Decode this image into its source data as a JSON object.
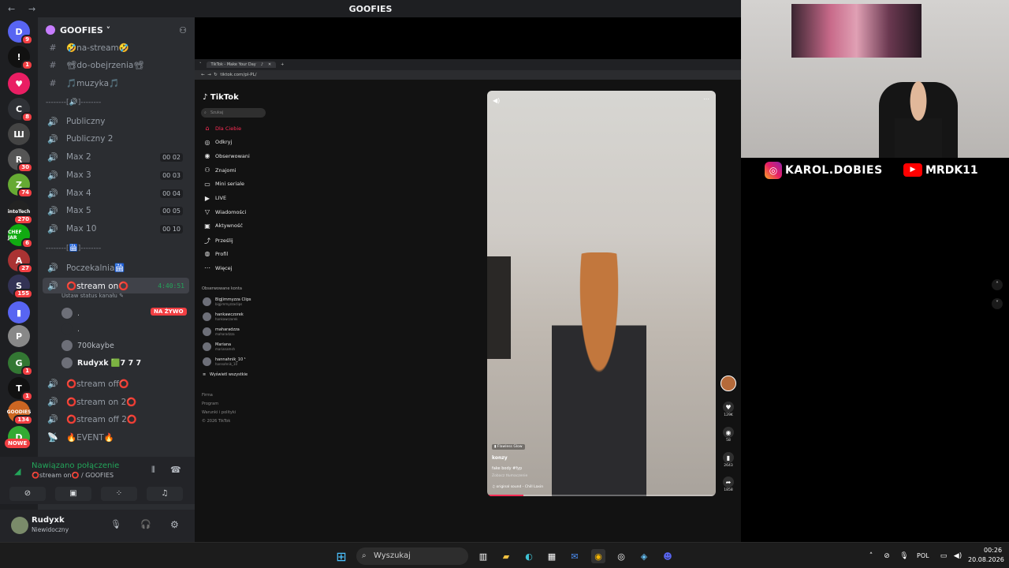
{
  "topbar": {
    "back": "←",
    "forward": "→",
    "title": "GOOFIES"
  },
  "rail": {
    "servers": [
      {
        "label": "D",
        "badge": "9",
        "color": "#5865f2"
      },
      {
        "label": "!",
        "badge": "1",
        "color": "#111"
      },
      {
        "label": "♥",
        "badge": "",
        "color": "#e91e63"
      },
      {
        "label": "C",
        "badge": "8",
        "color": "#2f3136"
      },
      {
        "label": "Ш",
        "badge": "",
        "color": "#444"
      },
      {
        "label": "R",
        "badge": "30",
        "color": "#555"
      },
      {
        "label": "Z",
        "badge": "74",
        "color": "#6a3"
      },
      {
        "label": "intoTech",
        "badge": "270",
        "color": "#222"
      },
      {
        "label": "CHEF JAR",
        "badge": "6",
        "color": "#1a1"
      },
      {
        "label": "A",
        "badge": "27",
        "color": "#a33"
      },
      {
        "label": "S",
        "badge": "155",
        "color": "#335"
      },
      {
        "label": "▮",
        "badge": "",
        "color": "#5865f2"
      },
      {
        "label": "P",
        "badge": "",
        "color": "#888"
      },
      {
        "label": "G",
        "badge": "1",
        "color": "#373"
      },
      {
        "label": "T",
        "badge": "1",
        "color": "#111"
      },
      {
        "label": "GOODIES",
        "badge": "134",
        "color": "#c62"
      },
      {
        "label": "D",
        "badge": "",
        "color": "#3a3"
      }
    ],
    "new_badge": "NOWE"
  },
  "guild": {
    "name": "GOOFIES ˅"
  },
  "channels": [
    {
      "icon": "#",
      "name": "🤣na-stream🤣",
      "limit": "",
      "type": "text"
    },
    {
      "icon": "#",
      "name": "📽do-obejrzenia📽",
      "limit": "",
      "type": "text"
    },
    {
      "icon": "#",
      "name": "🎵muzyka🎵",
      "limit": "",
      "type": "text"
    },
    {
      "icon": "🔊",
      "name": "Publiczny",
      "limit": "",
      "type": "voice"
    },
    {
      "icon": "🔊",
      "name": "Publiczny 2",
      "limit": "",
      "type": "voice"
    },
    {
      "icon": "🔊",
      "name": "Max 2",
      "limit": "00 02",
      "type": "voice"
    },
    {
      "icon": "🔊",
      "name": "Max 3",
      "limit": "00 03",
      "type": "voice"
    },
    {
      "icon": "🔊",
      "name": "Max 4",
      "limit": "00 04",
      "type": "voice"
    },
    {
      "icon": "🔊",
      "name": "Max 5",
      "limit": "00 05",
      "type": "voice"
    },
    {
      "icon": "🔊",
      "name": "Max 10",
      "limit": "00 10",
      "type": "voice"
    }
  ],
  "separators": [
    "--------[🔊]--------",
    "--------[🛗]--------"
  ],
  "waiting": {
    "icon": "🔊",
    "name": "Poczekalnia🛗"
  },
  "active": {
    "name": "⭕stream on⭕",
    "timer": "4:40:51",
    "status": "Ustaw status kanału ✎",
    "live": "NA ŻYWO",
    "members": [
      {
        "name": "."
      },
      {
        "name": "."
      },
      {
        "name": "700kaybe"
      },
      {
        "name": "Rudyxk 🟩7 7 7"
      }
    ]
  },
  "more_channels": [
    {
      "icon": "🔊",
      "name": "⭕stream off⭕"
    },
    {
      "icon": "🔊",
      "name": "⭕stream on 2⭕"
    },
    {
      "icon": "🔊",
      "name": "⭕stream off 2⭕"
    },
    {
      "icon": "📡",
      "name": "🔥EVENT🔥"
    }
  ],
  "voice": {
    "status": "Nawiązano połączenie",
    "detail": "⭕stream on⭕ / GOOFIES"
  },
  "user": {
    "name": "Rudyxk",
    "status": "Niewidoczny"
  },
  "browser": {
    "tab": "TikTok - Make Your Day",
    "url": "tiktok.com/pl-PL/",
    "logo": "TikTok",
    "search": "Szukaj",
    "nav": [
      {
        "icon": "⌂",
        "label": "Dla Ciebie"
      },
      {
        "icon": "◎",
        "label": "Odkryj"
      },
      {
        "icon": "◉",
        "label": "Obserwowani"
      },
      {
        "icon": "⚇",
        "label": "Znajomi"
      },
      {
        "icon": "▭",
        "label": "Mini seriale"
      },
      {
        "icon": "▶",
        "label": "LIVE"
      },
      {
        "icon": "▽",
        "label": "Wiadomości"
      },
      {
        "icon": "▣",
        "label": "Aktywność"
      },
      {
        "icon": "⤴",
        "label": "Prześlij"
      },
      {
        "icon": "◍",
        "label": "Profil"
      },
      {
        "icon": "⋯",
        "label": "Więcej"
      }
    ],
    "following_title": "Obserwowane konta",
    "accounts": [
      {
        "name": "BigJimmyzza Clips",
        "handle": "bigjimmyzzaclips"
      },
      {
        "name": "hankawczorek",
        "handle": "hankawczorek"
      },
      {
        "name": "maharadzza",
        "handle": "maharadzza"
      },
      {
        "name": "Mariana",
        "handle": "marianamsh"
      },
      {
        "name": "hannahnik_10 ¹",
        "handle": "hannahnik_10"
      }
    ],
    "show_all": "Wyświetl wszystkie",
    "footer": [
      "Firma",
      "Program",
      "Warunki i polityki",
      "© 2026 TikTok"
    ],
    "video": {
      "tag": "Flawless Glow",
      "user": "konzy",
      "caption": "fake body #fyp",
      "translate": "Zobacz tłumaczenie",
      "sound": "♫ original sound - Chill Laxin"
    },
    "stats": {
      "likes": "129K",
      "comments": "58",
      "saves": "2643",
      "shares": "1858"
    }
  },
  "socials": {
    "instagram": "KAROL.DOBIES",
    "youtube": "MRDK11"
  },
  "taskbar": {
    "search": "Wyszukaj",
    "lang": "POL",
    "time": "00:26",
    "date": "20.08.2026"
  }
}
